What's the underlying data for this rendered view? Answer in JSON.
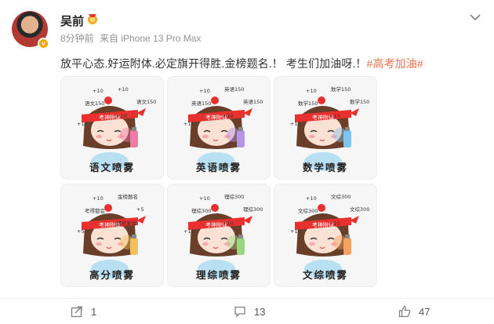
{
  "post": {
    "username": "吴前",
    "time": "8分钟前",
    "source": "来自 iPhone 13 Pro Max",
    "text_main": "放平心态.好运附体.必定旗开得胜.金榜题名.！ 考生们加油呀.！",
    "hashtag": "#高考加油#"
  },
  "grid": {
    "images": [
      {
        "caption": "语文喷雾",
        "labels": [
          "+10",
          "+10",
          "语文150",
          "语文150",
          "+10",
          "+10"
        ],
        "cap_text": "考神附体",
        "accent": "#f07aa8"
      },
      {
        "caption": "英语喷雾",
        "labels": [
          "+10",
          "英语150",
          "英语150",
          "英语150",
          "+10",
          "+10"
        ],
        "cap_text": "考神附体",
        "accent": "#b495e8"
      },
      {
        "caption": "数学喷雾",
        "labels": [
          "+10",
          "数学150",
          "数学150",
          "数学150",
          "+10",
          "+10"
        ],
        "cap_text": "考神附体",
        "accent": "#7ec5f0"
      },
      {
        "caption": "高分喷雾",
        "labels": [
          "+10",
          "金榜题名",
          "考得都会",
          "+5",
          "超常发挥",
          "+5"
        ],
        "cap_text": "考神附体",
        "accent": "#f2c15b"
      },
      {
        "caption": "理综喷雾",
        "labels": [
          "+10",
          "理综300",
          "理综300",
          "理综300",
          "+10",
          "+10"
        ],
        "cap_text": "考神附体",
        "accent": "#9ad67e"
      },
      {
        "caption": "文综喷雾",
        "labels": [
          "+10",
          "文综300",
          "文综300",
          "文综300",
          "+10",
          "+10"
        ],
        "cap_text": "考神附体",
        "accent": "#f4a261"
      }
    ]
  },
  "actions": {
    "share_count": "1",
    "comment_count": "13",
    "like_count": "47"
  },
  "colors": {
    "hashtag": "#eb7350",
    "meta": "#939393",
    "headband": "#e8302f"
  },
  "icons": [
    "avatar",
    "vip-badge-icon",
    "medal-icon",
    "chevron-down-icon",
    "share-icon",
    "comment-icon",
    "like-icon"
  ]
}
